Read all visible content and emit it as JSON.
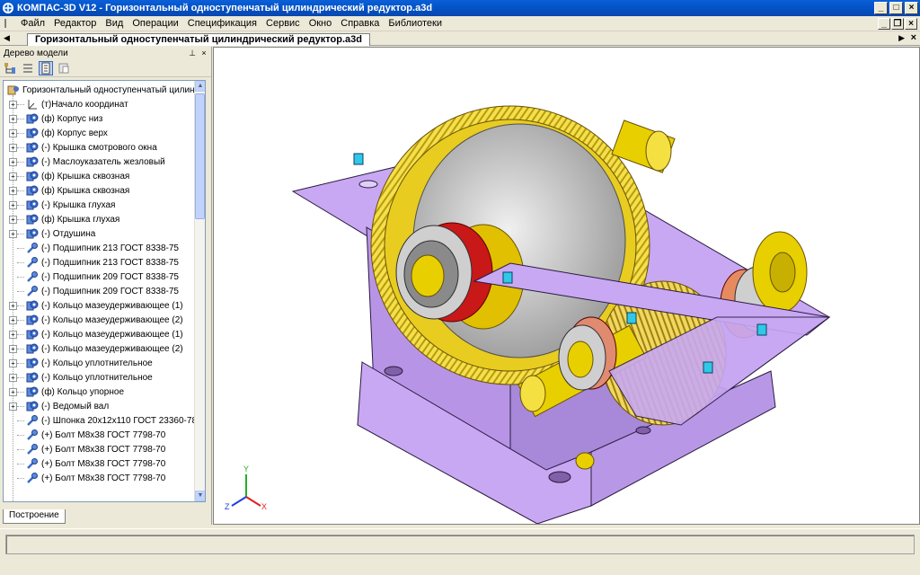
{
  "window": {
    "title": "КОМПАС-3D V12 - Горизонтальный одноступенчатый цилиндрический редуктор.a3d"
  },
  "menu": [
    "Файл",
    "Редактор",
    "Вид",
    "Операции",
    "Спецификация",
    "Сервис",
    "Окно",
    "Справка",
    "Библиотеки"
  ],
  "document_tab": {
    "label": "Горизонтальный одноступенчатый цилиндрический редуктор.a3d"
  },
  "model_tree": {
    "title": "Дерево модели",
    "bottom_tab": "Построение",
    "root": "Горизонтальный одноступенчатый цилиндрический редуктор",
    "items": [
      {
        "label": "(т)Начало координат",
        "icon": "axes-icon",
        "expandable": true
      },
      {
        "label": "(ф) Корпус низ",
        "icon": "part-icon",
        "expandable": true
      },
      {
        "label": "(ф) Корпус верх",
        "icon": "part-icon",
        "expandable": true
      },
      {
        "label": "(-) Крышка смотрового окна",
        "icon": "part-icon",
        "expandable": true
      },
      {
        "label": "(-) Маслоуказатель жезловый",
        "icon": "part-icon",
        "expandable": true
      },
      {
        "label": "(ф) Крышка сквозная",
        "icon": "part-icon",
        "expandable": true
      },
      {
        "label": "(ф) Крышка сквозная",
        "icon": "part-icon",
        "expandable": true
      },
      {
        "label": "(-) Крышка глухая",
        "icon": "part-icon",
        "expandable": true
      },
      {
        "label": "(ф) Крышка глухая",
        "icon": "part-icon",
        "expandable": true
      },
      {
        "label": "(-) Отдушина",
        "icon": "part-icon",
        "expandable": true
      },
      {
        "label": "(-) Подшипник 213 ГОСТ 8338-75",
        "icon": "standard-part-icon",
        "expandable": false
      },
      {
        "label": "(-) Подшипник 213 ГОСТ 8338-75",
        "icon": "standard-part-icon",
        "expandable": false
      },
      {
        "label": "(-) Подшипник 209 ГОСТ 8338-75",
        "icon": "standard-part-icon",
        "expandable": false
      },
      {
        "label": "(-) Подшипник 209 ГОСТ 8338-75",
        "icon": "standard-part-icon",
        "expandable": false
      },
      {
        "label": "(-) Кольцо мазеудерживающее (1)",
        "icon": "part-icon",
        "expandable": true
      },
      {
        "label": "(-) Кольцо мазеудерживающее (2)",
        "icon": "part-icon",
        "expandable": true
      },
      {
        "label": "(-) Кольцо мазеудерживающее (1)",
        "icon": "part-icon",
        "expandable": true
      },
      {
        "label": "(-) Кольцо мазеудерживающее (2)",
        "icon": "part-icon",
        "expandable": true
      },
      {
        "label": "(-) Кольцо уплотнительное",
        "icon": "part-icon",
        "expandable": true
      },
      {
        "label": "(-) Кольцо уплотнительное",
        "icon": "part-icon",
        "expandable": true
      },
      {
        "label": "(ф) Кольцо упорное",
        "icon": "part-icon",
        "expandable": true
      },
      {
        "label": "(-) Ведомый вал",
        "icon": "part-icon",
        "expandable": true
      },
      {
        "label": "(-) Шпонка 20x12x110 ГОСТ 23360-78",
        "icon": "standard-part-icon",
        "expandable": false
      },
      {
        "label": "(+) Болт М8x38 ГОСТ 7798-70",
        "icon": "standard-part-icon",
        "expandable": false
      },
      {
        "label": "(+) Болт М8x38 ГОСТ 7798-70",
        "icon": "standard-part-icon",
        "expandable": false
      },
      {
        "label": "(+) Болт М8x38 ГОСТ 7798-70",
        "icon": "standard-part-icon",
        "expandable": false
      },
      {
        "label": "(+) Болт М8x38 ГОСТ 7798-70",
        "icon": "standard-part-icon",
        "expandable": false
      }
    ]
  },
  "viewport": {
    "axis_labels": {
      "x": "X",
      "y": "Y",
      "z": "Z"
    }
  },
  "colors": {
    "housing": "#c49ef0",
    "gear": "#e8d000",
    "axis_x": "#e02020",
    "axis_y": "#20b020",
    "axis_z": "#2040e0"
  }
}
